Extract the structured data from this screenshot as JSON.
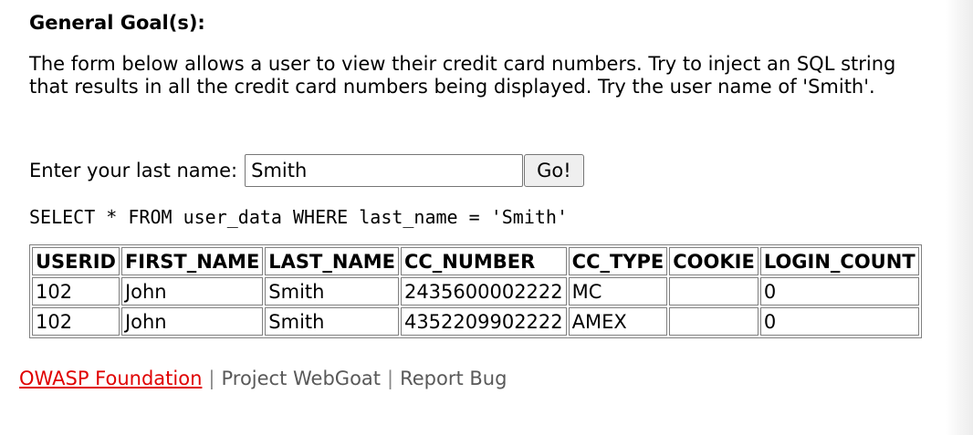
{
  "goal": {
    "heading": "General Goal(s):",
    "description": "The form below allows a user to view their credit card numbers. Try to inject an SQL string that results in all the credit card numbers being displayed. Try the user name of 'Smith'."
  },
  "form": {
    "label": "Enter your last name:",
    "input_value": "Smith",
    "button_label": "Go!"
  },
  "query": "SELECT * FROM user_data WHERE last_name = 'Smith'",
  "table": {
    "headers": [
      "USERID",
      "FIRST_NAME",
      "LAST_NAME",
      "CC_NUMBER",
      "CC_TYPE",
      "COOKIE",
      "LOGIN_COUNT"
    ],
    "rows": [
      [
        "102",
        "John",
        "Smith",
        "2435600002222",
        "MC",
        "",
        "0"
      ],
      [
        "102",
        "John",
        "Smith",
        "4352209902222",
        "AMEX",
        "",
        "0"
      ]
    ]
  },
  "footer": {
    "link": "OWASP Foundation",
    "separator": "|",
    "project": "Project WebGoat",
    "report": "Report Bug"
  },
  "colors": {
    "link": "#e00000",
    "footer_text": "#595959"
  }
}
